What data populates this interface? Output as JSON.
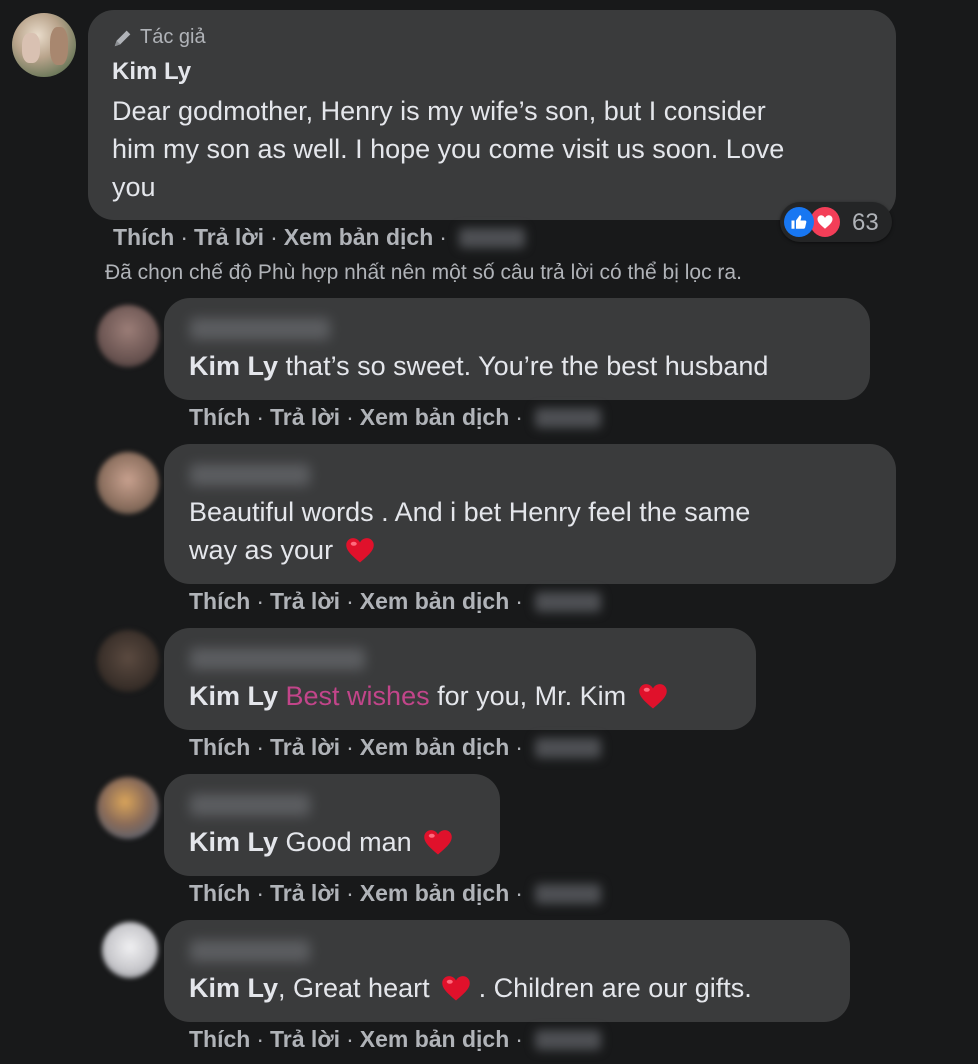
{
  "main_comment": {
    "badge": "Tác giả",
    "author": "Kim Ly",
    "lines": [
      "Dear godmother, Henry is my wife’s son, but I consider",
      "him my son as well. I hope you come visit us soon. Love",
      "you"
    ],
    "reaction_count": "63",
    "reaction_icons": [
      "like-icon",
      "love-icon"
    ]
  },
  "actions": {
    "like": "Thích",
    "reply": "Trả lời",
    "translate": "Xem bản dịch",
    "sep": "·"
  },
  "notice": "Đã chọn chế độ Phù hợp nhất nên một số câu trả lời có thể bị lọc ra.",
  "replies": [
    {
      "mention": "Kim Ly",
      "lines": [
        "that’s so sweet. You’re the best husband"
      ]
    },
    {
      "mention": "",
      "lines": [
        "Beautiful words . And i bet Henry feel the same",
        "way as your"
      ]
    },
    {
      "mention": "Kim Ly",
      "tag": "Best wishes",
      "rest": "for you, Mr. Kim"
    },
    {
      "mention": "Kim Ly",
      "lines": [
        "Good man"
      ]
    },
    {
      "mention": "Kim Ly",
      "before": ", Great heart",
      "after": ". Children are our gifts."
    }
  ],
  "colors": {
    "background": "#18191a",
    "bubble": "#3a3b3c",
    "tag": "#c2458a",
    "heart": "#f02849",
    "like_blue": "#1877f2"
  }
}
